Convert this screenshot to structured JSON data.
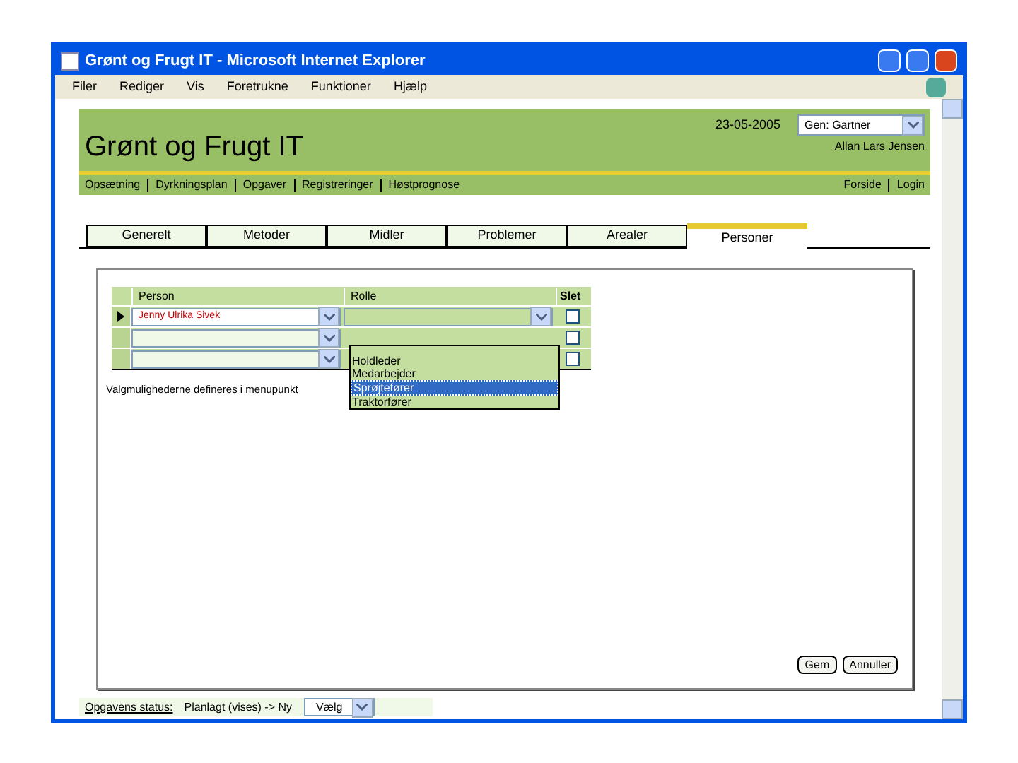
{
  "window": {
    "title": "Grønt og Frugt IT - Microsoft Internet Explorer"
  },
  "menu": [
    "Filer",
    "Rediger",
    "Vis",
    "Foretrukne",
    "Funktioner",
    "Hjælp"
  ],
  "header": {
    "title": "Grønt og Frugt IT",
    "date": "23-05-2005",
    "role_select": "Gen: Gartner",
    "user": "Allan Lars Jensen"
  },
  "nav": [
    "Opsætning",
    "Dyrkningsplan",
    "Opgaver",
    "Registreringer",
    "Høstprognose"
  ],
  "nav_right": [
    "Forside",
    "Login"
  ],
  "tabs": [
    {
      "label": "Generelt",
      "selected": false
    },
    {
      "label": "Metoder",
      "selected": false
    },
    {
      "label": "Midler",
      "selected": false
    },
    {
      "label": "Problemer",
      "selected": false
    },
    {
      "label": "Arealer",
      "selected": false
    },
    {
      "label": "Personer",
      "selected": true
    }
  ],
  "table": {
    "columns": [
      "Person",
      "Rolle",
      "Slet"
    ],
    "rows": [
      {
        "person": "Jenny Ulrika Sivek",
        "current": true,
        "delete": false
      },
      {
        "current": false,
        "delete": false
      },
      {
        "current": false,
        "delete": false
      }
    ]
  },
  "role_dropdown": [
    {
      "label": "Holdleder",
      "selected": false
    },
    {
      "label": "Medarbejder",
      "selected": false
    },
    {
      "label": "Sprøjtefører",
      "selected": true
    },
    {
      "label": "Traktorfører",
      "selected": false
    }
  ],
  "note": "Valgmulighederne defineres i menupunkt",
  "buttons": [
    "Gem",
    "Annuller"
  ],
  "status": {
    "label": "Opgavens status:",
    "value": "Planlagt (vises) -> Ny",
    "select": "Vælg"
  }
}
